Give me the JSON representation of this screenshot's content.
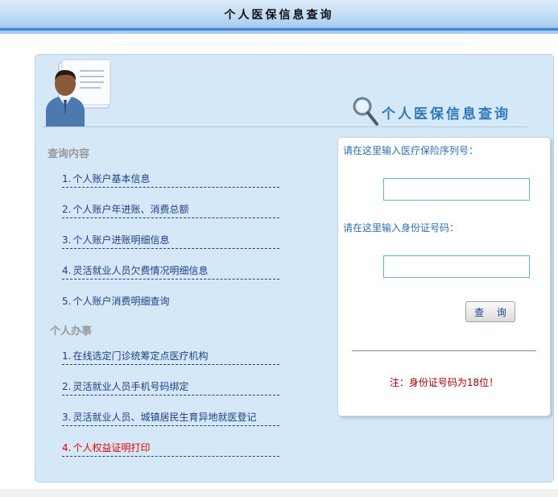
{
  "window": {
    "title": "个人医保信息查询"
  },
  "header": {
    "title": "个人医保信息查询"
  },
  "sections": [
    {
      "title": "查询内容",
      "items": [
        {
          "num": "1.",
          "label": "个人账户基本信息"
        },
        {
          "num": "2.",
          "label": "个人账户年进账、消费总额"
        },
        {
          "num": "3.",
          "label": "个人账户进账明细信息"
        },
        {
          "num": "4.",
          "label": "灵活就业人员欠费情况明细信息"
        },
        {
          "num": "5.",
          "label": "个人账户消费明细查询"
        }
      ]
    },
    {
      "title": "个人办事",
      "items": [
        {
          "num": "1.",
          "label": "在线选定门诊统筹定点医疗机构"
        },
        {
          "num": "2.",
          "label": "灵活就业人员手机号码绑定"
        },
        {
          "num": "3.",
          "label": "灵活就业人员、城镇居民生育异地就医登记"
        },
        {
          "num": "4.",
          "label": "个人权益证明打印"
        }
      ]
    }
  ],
  "form": {
    "insurance_label": "请在这里输入医疗保险序列号：",
    "insurance_value": "",
    "id_label": "请在这里输入身份证号码：",
    "id_value": "",
    "submit_label": "查 询",
    "note": "注：身份证号码为18位！"
  },
  "colors": {
    "link": "#1f3f88",
    "link_highlight": "#e40000",
    "panel_bg": "#d5e8f8",
    "note": "#a00000"
  },
  "icons": [
    "person-card-icon",
    "magnifier-icon"
  ]
}
